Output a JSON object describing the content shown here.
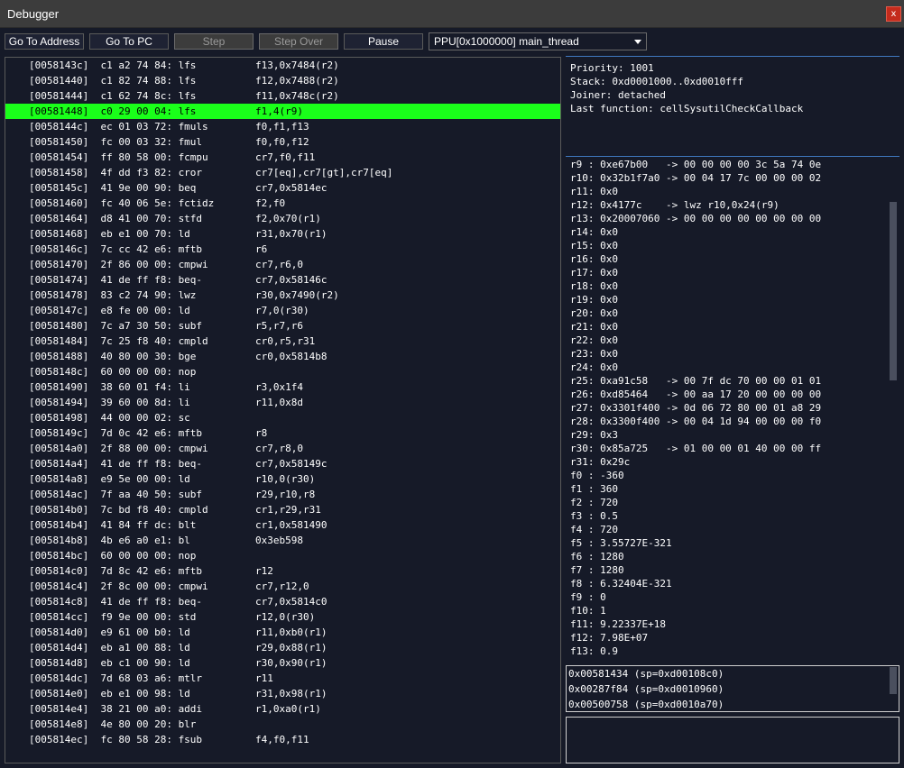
{
  "window": {
    "title": "Debugger",
    "close_label": "x"
  },
  "toolbar": {
    "go_to_address": "Go To Address",
    "go_to_pc": "Go To PC",
    "step": "Step",
    "step_over": "Step Over",
    "pause": "Pause",
    "thread": "PPU[0x1000000] main_thread"
  },
  "disasm": [
    {
      "addr": "[0058143c]  c1 a2 74 84: lfs",
      "ops": "f13,0x7484(r2)"
    },
    {
      "addr": "[00581440]  c1 82 74 88: lfs",
      "ops": "f12,0x7488(r2)"
    },
    {
      "addr": "[00581444]  c1 62 74 8c: lfs",
      "ops": "f11,0x748c(r2)"
    },
    {
      "addr": "[00581448]  c0 29 00 04: lfs",
      "ops": "f1,4(r9)"
    },
    {
      "addr": "[0058144c]  ec 01 03 72: fmuls",
      "ops": "f0,f1,f13"
    },
    {
      "addr": "[00581450]  fc 00 03 32: fmul",
      "ops": "f0,f0,f12"
    },
    {
      "addr": "[00581454]  ff 80 58 00: fcmpu",
      "ops": "cr7,f0,f11"
    },
    {
      "addr": "[00581458]  4f dd f3 82: cror",
      "ops": "cr7[eq],cr7[gt],cr7[eq]"
    },
    {
      "addr": "[0058145c]  41 9e 00 90: beq",
      "ops": "cr7,0x5814ec"
    },
    {
      "addr": "[00581460]  fc 40 06 5e: fctidz",
      "ops": "f2,f0"
    },
    {
      "addr": "[00581464]  d8 41 00 70: stfd",
      "ops": "f2,0x70(r1)"
    },
    {
      "addr": "[00581468]  eb e1 00 70: ld",
      "ops": "r31,0x70(r1)"
    },
    {
      "addr": "[0058146c]  7c cc 42 e6: mftb",
      "ops": "r6"
    },
    {
      "addr": "[00581470]  2f 86 00 00: cmpwi",
      "ops": "cr7,r6,0"
    },
    {
      "addr": "[00581474]  41 de ff f8: beq-",
      "ops": "cr7,0x58146c"
    },
    {
      "addr": "[00581478]  83 c2 74 90: lwz",
      "ops": "r30,0x7490(r2)"
    },
    {
      "addr": "[0058147c]  e8 fe 00 00: ld",
      "ops": "r7,0(r30)"
    },
    {
      "addr": "[00581480]  7c a7 30 50: subf",
      "ops": "r5,r7,r6"
    },
    {
      "addr": "[00581484]  7c 25 f8 40: cmpld",
      "ops": "cr0,r5,r31"
    },
    {
      "addr": "[00581488]  40 80 00 30: bge",
      "ops": "cr0,0x5814b8"
    },
    {
      "addr": "[0058148c]  60 00 00 00: nop",
      "ops": ""
    },
    {
      "addr": "[00581490]  38 60 01 f4: li",
      "ops": "r3,0x1f4"
    },
    {
      "addr": "[00581494]  39 60 00 8d: li",
      "ops": "r11,0x8d"
    },
    {
      "addr": "[00581498]  44 00 00 02: sc",
      "ops": ""
    },
    {
      "addr": "[0058149c]  7d 0c 42 e6: mftb",
      "ops": "r8"
    },
    {
      "addr": "[005814a0]  2f 88 00 00: cmpwi",
      "ops": "cr7,r8,0"
    },
    {
      "addr": "[005814a4]  41 de ff f8: beq-",
      "ops": "cr7,0x58149c"
    },
    {
      "addr": "[005814a8]  e9 5e 00 00: ld",
      "ops": "r10,0(r30)"
    },
    {
      "addr": "[005814ac]  7f aa 40 50: subf",
      "ops": "r29,r10,r8"
    },
    {
      "addr": "[005814b0]  7c bd f8 40: cmpld",
      "ops": "cr1,r29,r31"
    },
    {
      "addr": "[005814b4]  41 84 ff dc: blt",
      "ops": "cr1,0x581490"
    },
    {
      "addr": "[005814b8]  4b e6 a0 e1: bl",
      "ops": "0x3eb598"
    },
    {
      "addr": "[005814bc]  60 00 00 00: nop",
      "ops": ""
    },
    {
      "addr": "[005814c0]  7d 8c 42 e6: mftb",
      "ops": "r12"
    },
    {
      "addr": "[005814c4]  2f 8c 00 00: cmpwi",
      "ops": "cr7,r12,0"
    },
    {
      "addr": "[005814c8]  41 de ff f8: beq-",
      "ops": "cr7,0x5814c0"
    },
    {
      "addr": "[005814cc]  f9 9e 00 00: std",
      "ops": "r12,0(r30)"
    },
    {
      "addr": "[005814d0]  e9 61 00 b0: ld",
      "ops": "r11,0xb0(r1)"
    },
    {
      "addr": "[005814d4]  eb a1 00 88: ld",
      "ops": "r29,0x88(r1)"
    },
    {
      "addr": "[005814d8]  eb c1 00 90: ld",
      "ops": "r30,0x90(r1)"
    },
    {
      "addr": "[005814dc]  7d 68 03 a6: mtlr",
      "ops": "r11"
    },
    {
      "addr": "[005814e0]  eb e1 00 98: ld",
      "ops": "r31,0x98(r1)"
    },
    {
      "addr": "[005814e4]  38 21 00 a0: addi",
      "ops": "r1,0xa0(r1)"
    },
    {
      "addr": "[005814e8]  4e 80 00 20: blr",
      "ops": ""
    },
    {
      "addr": "[005814ec]  fc 80 58 28: fsub",
      "ops": "f4,f0,f11"
    }
  ],
  "thread_info": {
    "priority": "Priority: 1001",
    "stack": "Stack: 0xd0001000..0xd0010fff",
    "joiner": "Joiner: detached",
    "last_function": "Last function: cellSysutilCheckCallback"
  },
  "registers": [
    "r9 : 0xe67b00   -> 00 00 00 00 3c 5a 74 0e",
    "r10: 0x32b1f7a0 -> 00 04 17 7c 00 00 00 02",
    "r11: 0x0",
    "r12: 0x4177c    -> lwz r10,0x24(r9)",
    "r13: 0x20007060 -> 00 00 00 00 00 00 00 00",
    "r14: 0x0",
    "r15: 0x0",
    "r16: 0x0",
    "r17: 0x0",
    "r18: 0x0",
    "r19: 0x0",
    "r20: 0x0",
    "r21: 0x0",
    "r22: 0x0",
    "r23: 0x0",
    "r24: 0x0",
    "r25: 0xa91c58   -> 00 7f dc 70 00 00 01 01",
    "r26: 0xd85464   -> 00 aa 17 20 00 00 00 00",
    "r27: 0x3301f400 -> 0d 06 72 80 00 01 a8 29",
    "r28: 0x3300f400 -> 00 04 1d 94 00 00 00 f0",
    "r29: 0x3",
    "r30: 0x85a725   -> 01 00 00 01 40 00 00 ff",
    "r31: 0x29c",
    "f0 : -360",
    "f1 : 360",
    "f2 : 720",
    "f3 : 0.5",
    "f4 : 720",
    "f5 : 3.55727E-321",
    "f6 : 1280",
    "f7 : 1280",
    "f8 : 6.32404E-321",
    "f9 : 0",
    "f10: 1",
    "f11: 9.22337E+18",
    "f12: 7.98E+07",
    "f13: 0.9"
  ],
  "call_stack": [
    "0x00581434 (sp=0xd00108c0)",
    "0x00287f84 (sp=0xd0010960)",
    "0x00500758 (sp=0xd0010a70)"
  ],
  "colors": {
    "current_line": "#1aff1a",
    "background": "#161a28",
    "separator": "#3f78bf"
  }
}
